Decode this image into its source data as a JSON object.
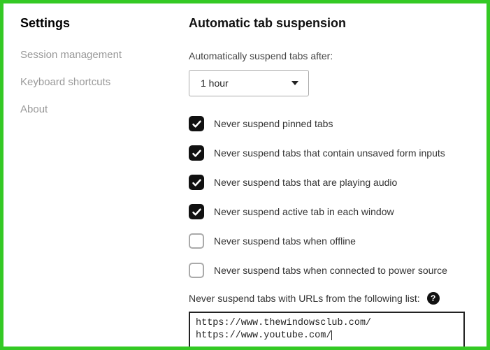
{
  "sidebar": {
    "items": [
      {
        "label": "Settings",
        "active": true
      },
      {
        "label": "Session management",
        "active": false
      },
      {
        "label": "Keyboard shortcuts",
        "active": false
      },
      {
        "label": "About",
        "active": false
      }
    ]
  },
  "main": {
    "title": "Automatic tab suspension",
    "suspend_label": "Automatically suspend tabs after:",
    "suspend_value": "1 hour",
    "options": [
      {
        "label": "Never suspend pinned tabs",
        "checked": true
      },
      {
        "label": "Never suspend tabs that contain unsaved form inputs",
        "checked": true
      },
      {
        "label": "Never suspend tabs that are playing audio",
        "checked": true
      },
      {
        "label": "Never suspend active tab in each window",
        "checked": true
      },
      {
        "label": "Never suspend tabs when offline",
        "checked": false
      },
      {
        "label": "Never suspend tabs when connected to power source",
        "checked": false
      }
    ],
    "whitelist_label": "Never suspend tabs with URLs from the following list:",
    "help_glyph": "?",
    "whitelist_urls": [
      "https://www.thewindowsclub.com/",
      "https://www.youtube.com/"
    ]
  }
}
